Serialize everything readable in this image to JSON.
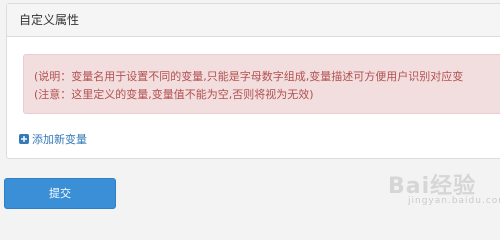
{
  "panel": {
    "title": "自定义属性",
    "alert": {
      "line1": "(说明：变量名用于设置不同的变量,只能是字母数字组成,变量描述可方便用户识别对应变",
      "line2": "(注意：这里定义的变量,变量值不能为空,否则将视为无效)"
    },
    "add_variable_label": "添加新变量"
  },
  "form": {
    "submit_label": "提交"
  },
  "watermark": {
    "brand": "Bai经验",
    "sub": "jingyan.baidu.com"
  },
  "colors": {
    "accent": "#3a8fd6",
    "link": "#337ab7",
    "alert_bg": "#f2dede",
    "alert_text": "#b25151"
  },
  "icons": {
    "add": "plus-square-icon"
  }
}
